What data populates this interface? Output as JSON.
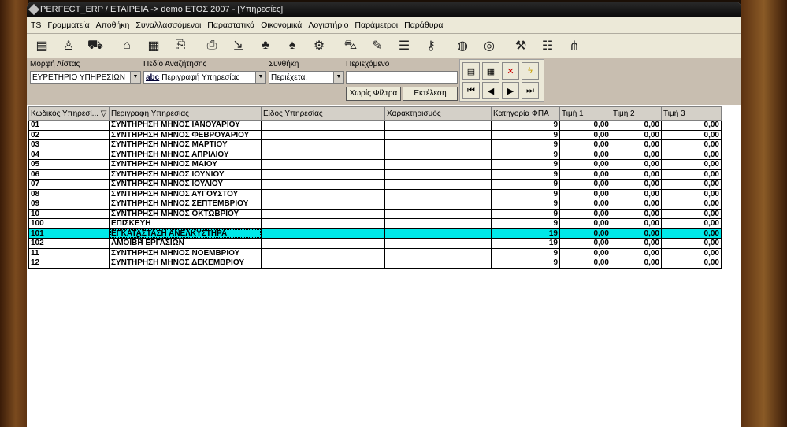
{
  "window": {
    "title": "PERFECT_ERP / ΕΤΑΙΡΕΙΑ -> demo ΕΤΟΣ 2007 - [Υπηρεσίες]"
  },
  "menu": [
    "TS",
    "Γραμματεία",
    "Αποθήκη",
    "Συναλλασσόμενοι",
    "Παραστατικά",
    "Οικονομικά",
    "Λογιστήριο",
    "Παράμετροι",
    "Παράθυρα"
  ],
  "filters": {
    "list_form_label": "Μορφή Λίστας",
    "list_form_value": "ΕΥΡΕΤΗΡΙΟ ΥΠΗΡΕΣΙΩΝ",
    "search_field_label": "Πεδίο Αναζήτησης",
    "search_field_value": "Περιγραφή Υπηρεσίας",
    "search_field_icon_text": "abc",
    "condition_label": "Συνθήκη",
    "condition_value": "Περιέχεται",
    "content_label": "Περιεχόμενο",
    "content_value": "",
    "no_filter_button": "Χωρίς Φίλτρα",
    "execute_button": "Εκτέλεση"
  },
  "table": {
    "columns": [
      "Κωδικός Υπηρεσί... ▽",
      "Περιγραφή Υπηρεσίας",
      "Είδος Υπηρεσίας",
      "Χαρακτηρισμός",
      "Κατηγορία ΦΠΑ",
      "Τιμή 1",
      "Τιμή 2",
      "Τιμή 3"
    ],
    "rows": [
      [
        "01",
        "ΣΥΝΤΗΡΗΣΗ ΜΗΝΟΣ ΙΑΝΟΥΑΡΙΟΥ",
        "",
        "",
        "9",
        "0,00",
        "0,00",
        "0,00"
      ],
      [
        "02",
        "ΣΥΝΤΗΡΗΣΗ ΜΗΝΟΣ ΦΕΒΡΟΥΑΡΙΟΥ",
        "",
        "",
        "9",
        "0,00",
        "0,00",
        "0,00"
      ],
      [
        "03",
        "ΣΥΝΤΗΡΗΣΗ ΜΗΝΟΣ ΜΑΡΤΙΟΥ",
        "",
        "",
        "9",
        "0,00",
        "0,00",
        "0,00"
      ],
      [
        "04",
        "ΣΥΝΤΗΡΗΣΗ ΜΗΝΟΣ ΑΠΡΙΛΙΟΥ",
        "",
        "",
        "9",
        "0,00",
        "0,00",
        "0,00"
      ],
      [
        "05",
        "ΣΥΝΤΗΡΗΣΗ ΜΗΝΟΣ ΜΑΙΟΥ",
        "",
        "",
        "9",
        "0,00",
        "0,00",
        "0,00"
      ],
      [
        "06",
        "ΣΥΝΤΗΡΗΣΗ ΜΗΝΟΣ ΙΟΥΝΙΟΥ",
        "",
        "",
        "9",
        "0,00",
        "0,00",
        "0,00"
      ],
      [
        "07",
        "ΣΥΝΤΗΡΗΣΗ ΜΗΝΟΣ ΙΟΥΛΙΟΥ",
        "",
        "",
        "9",
        "0,00",
        "0,00",
        "0,00"
      ],
      [
        "08",
        "ΣΥΝΤΗΡΗΣΗ ΜΗΝΟΣ ΑΥΓΟΥΣΤΟΥ",
        "",
        "",
        "9",
        "0,00",
        "0,00",
        "0,00"
      ],
      [
        "09",
        "ΣΥΝΤΗΡΗΣΗ ΜΗΝΟΣ ΣΕΠΤΕΜΒΡΙΟΥ",
        "",
        "",
        "9",
        "0,00",
        "0,00",
        "0,00"
      ],
      [
        "10",
        "ΣΥΝΤΗΡΗΣΗ ΜΗΝΟΣ ΟΚΤΩΒΡΙΟΥ",
        "",
        "",
        "9",
        "0,00",
        "0,00",
        "0,00"
      ],
      [
        "100",
        "ΕΠΙΣΚΕΥΗ",
        "",
        "",
        "9",
        "0,00",
        "0,00",
        "0,00"
      ],
      [
        "101",
        "ΕΓΚΑΤΑΣΤΑΣΗ ΑΝΕΛΚΥΣΤΗΡΑ",
        "",
        "",
        "19",
        "0,00",
        "0,00",
        "0,00"
      ],
      [
        "102",
        "ΑΜΟΙΒΗ ΕΡΓΑΣΙΩΝ",
        "",
        "",
        "19",
        "0,00",
        "0,00",
        "0,00"
      ],
      [
        "11",
        "ΣΥΝΤΗΡΗΣΗ ΜΗΝΟΣ ΝΟΕΜΒΡΙΟΥ",
        "",
        "",
        "9",
        "0,00",
        "0,00",
        "0,00"
      ],
      [
        "12",
        "ΣΥΝΤΗΡΗΣΗ ΜΗΝΟΣ ΔΕΚΕΜΒΡΙΟΥ",
        "",
        "",
        "9",
        "0,00",
        "0,00",
        "0,00"
      ]
    ],
    "selected_row": 11
  }
}
